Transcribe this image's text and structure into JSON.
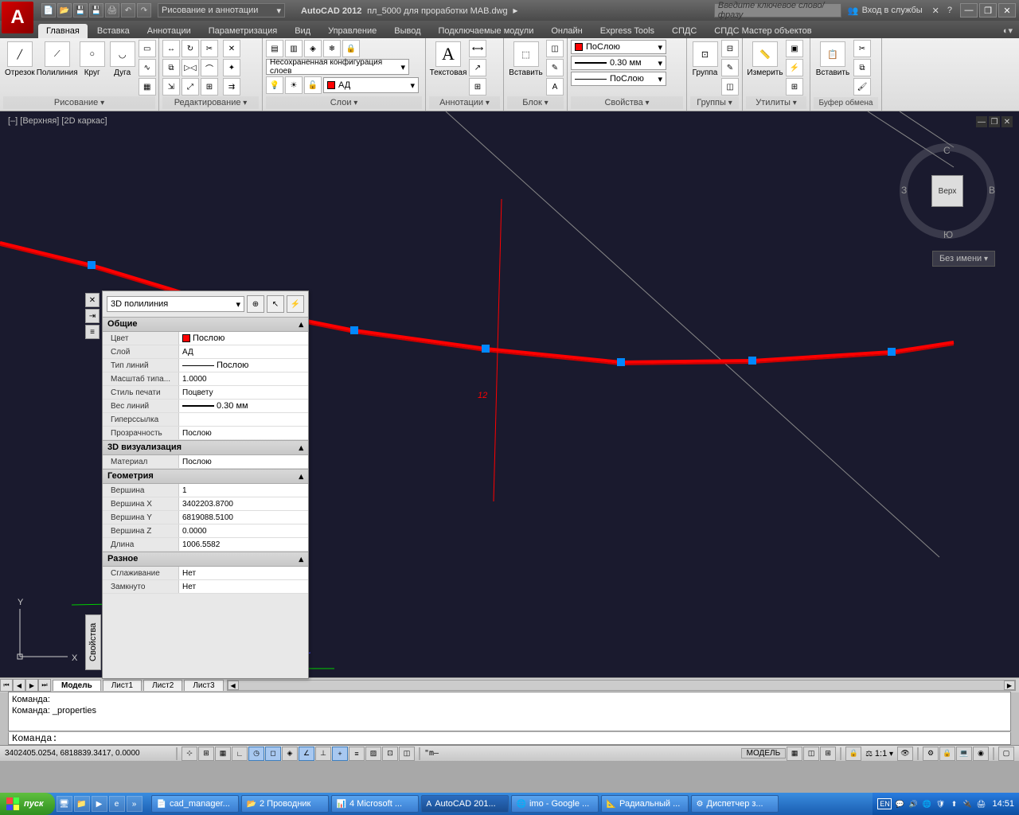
{
  "app": {
    "name": "AutoCAD 2012",
    "file": "пл_5000 для проработки МАВ.dwg",
    "workspace": "Рисование и аннотации",
    "search_placeholder": "Введите ключевое слово/фразу",
    "login": "Вход в службы"
  },
  "ribbon": {
    "tabs": [
      "Главная",
      "Вставка",
      "Аннотации",
      "Параметризация",
      "Вид",
      "Управление",
      "Вывод",
      "Подключаемые модули",
      "Онлайн",
      "Express Tools",
      "СПДС",
      "СПДС Мастер объектов"
    ],
    "panels": {
      "draw": "Рисование",
      "modify": "Редактирование",
      "layers": "Слои",
      "annot": "Аннотации",
      "block": "Блок",
      "props": "Свойства",
      "groups": "Группы",
      "utils": "Утилиты",
      "clip": "Буфер обмена"
    },
    "draw_btns": {
      "line": "Отрезок",
      "pline": "Полилиния",
      "circle": "Круг",
      "arc": "Дуга"
    },
    "layer_config": "Несохраненная конфигурация слоев",
    "current_layer": "АД",
    "annot_big": "A",
    "annot_label": "Текстовая",
    "block_label": "Вставить",
    "props_bylayer": "ПоСлою",
    "props_lw": "0.30 мм",
    "group_label": "Группа",
    "util_label": "Измерить",
    "paste_label": "Вставить"
  },
  "view": {
    "label": "[–] [Верхняя] [2D каркас]",
    "cube_face": "Верх",
    "dir_n": "С",
    "dir_s": "Ю",
    "dir_e": "В",
    "dir_w": "З",
    "unnamed": "Без имени",
    "text12": "12"
  },
  "props": {
    "title": "Свойства",
    "object_type": "3D полилиния",
    "sections": {
      "general": "Общие",
      "viz3d": "3D визуализация",
      "geom": "Геометрия",
      "misc": "Разное"
    },
    "rows": {
      "color_lbl": "Цвет",
      "color_val": "Послою",
      "layer_lbl": "Слой",
      "layer_val": "АД",
      "ltype_lbl": "Тип линий",
      "ltype_val": "Послою",
      "ltscale_lbl": "Масштаб типа...",
      "ltscale_val": "1.0000",
      "plot_lbl": "Стиль печати",
      "plot_val": "Поцвету",
      "lw_lbl": "Вес линий",
      "lw_val": "0.30 мм",
      "hyper_lbl": "Гиперссылка",
      "hyper_val": "",
      "trans_lbl": "Прозрачность",
      "trans_val": "Послою",
      "mat_lbl": "Материал",
      "mat_val": "Послою",
      "vtx_lbl": "Вершина",
      "vtx_val": "1",
      "vx_lbl": "Вершина X",
      "vx_val": "3402203.8700",
      "vy_lbl": "Вершина Y",
      "vy_val": "6819088.5100",
      "vz_lbl": "Вершина Z",
      "vz_val": "0.0000",
      "len_lbl": "Длина",
      "len_val": "1006.5582",
      "smooth_lbl": "Сглаживание",
      "smooth_val": "Нет",
      "closed_lbl": "Замкнуто",
      "closed_val": "Нет"
    }
  },
  "tabs": {
    "model": "Модель",
    "l1": "Лист1",
    "l2": "Лист2",
    "l3": "Лист3"
  },
  "cmd": {
    "line1": "Команда:",
    "line2": "Команда: _properties",
    "line3": "",
    "prompt": "Команда:"
  },
  "status": {
    "coords": "3402405.0254, 6818839.3417, 0.0000",
    "dyn": "\"m—",
    "model": "МОДЕЛЬ",
    "scale": "1:1"
  },
  "taskbar": {
    "start": "пуск",
    "items": [
      "cad_manager...",
      "2 Проводник",
      "4 Microsoft ...",
      "AutoCAD 201...",
      "imo - Google ...",
      "Радиальный ...",
      "Диспетчер з..."
    ],
    "lang": "EN",
    "time": "14:51"
  }
}
